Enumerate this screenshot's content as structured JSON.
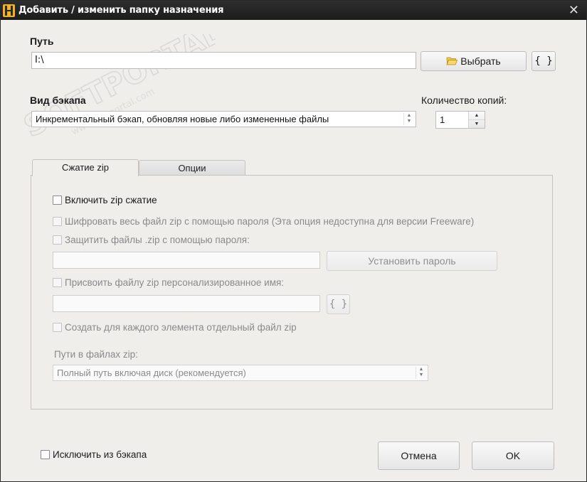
{
  "titlebar": {
    "title": "Добавить / изменить папку назначения",
    "close_glyph": "✕"
  },
  "path": {
    "label": "Путь",
    "value": "I:\\",
    "browse_label": "Выбрать",
    "browse_icon": "folder-open-icon",
    "vars_label": "{ }"
  },
  "backup_type": {
    "label": "Вид бэкапа",
    "selected": "Инкрементальный бэкап, обновляя новые либо измененные файлы"
  },
  "copies": {
    "label": "Количество копий:",
    "value": "1"
  },
  "tabs": [
    {
      "label": "Сжатие zip",
      "active": true
    },
    {
      "label": "Опции",
      "active": false
    }
  ],
  "zip": {
    "enable_label": "Включить zip сжатие",
    "encrypt_label": "Шифровать весь файл zip с помощью пароля (Эта опция недоступна для версии Freeware)",
    "protect_label": "Защитить файлы .zip с помощью пароля:",
    "password_value": "",
    "set_password_label": "Установить пароль",
    "custom_name_label": "Присвоить файлу zip персонализированное имя:",
    "custom_name_value": "",
    "custom_vars_label": "{ }",
    "per_item_label": "Создать для каждого элемента отдельный файл zip",
    "paths_label": "Пути в файлах zip:",
    "paths_selected": "Полный путь включая диск (рекомендуется)"
  },
  "footer": {
    "exclude_label": "Исключить из бэкапа",
    "cancel_label": "Отмена",
    "ok_label": "OK"
  },
  "watermark": {
    "brand": "SOFTPORTAL",
    "url": "www.softportal.com"
  },
  "colors": {
    "dialog_bg": "#f0eeeb",
    "titlebar_bg": "#222222",
    "app_icon": "#f0b222",
    "folder_icon": "#e8b93a"
  }
}
